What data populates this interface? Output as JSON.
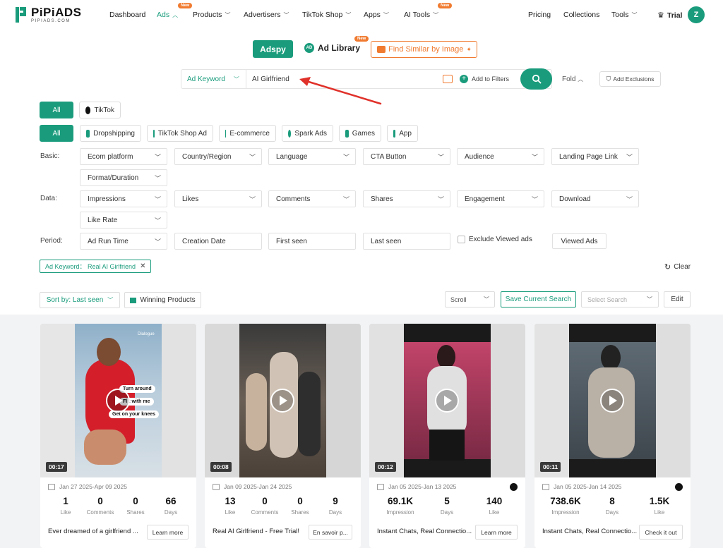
{
  "nav": {
    "logo_main": "PiPiADS",
    "logo_sub": "PIPIADS.COM",
    "items": [
      {
        "label": "Dashboard"
      },
      {
        "label": "Ads",
        "badge": "New"
      },
      {
        "label": "Products"
      },
      {
        "label": "Advertisers"
      },
      {
        "label": "TikTok Shop"
      },
      {
        "label": "Apps"
      },
      {
        "label": "AI Tools",
        "badge": "New"
      },
      {
        "label": "Pricing"
      },
      {
        "label": "Collections"
      },
      {
        "label": "Tools"
      },
      {
        "label": "Trial"
      }
    ],
    "avatar_initial": "Z"
  },
  "modes": {
    "adspy": "Adspy",
    "ad_library": "Ad Library",
    "ad_library_badge": "New",
    "find_similar": "Find Similar by Image"
  },
  "search": {
    "type": "Ad Keyword",
    "value": "AI Girlfriend",
    "add_to_filters": "Add to Filters",
    "fold": "Fold",
    "add_exclusions": "Add Exclusions"
  },
  "platforms": {
    "all": "All",
    "tiktok": "TikTok"
  },
  "categories": {
    "all": "All",
    "items": [
      "Dropshipping",
      "TikTok Shop Ad",
      "E-commerce",
      "Spark Ads",
      "Games",
      "App"
    ]
  },
  "filters": {
    "basic_label": "Basic:",
    "basic": [
      "Ecom platform",
      "Country/Region",
      "Language",
      "CTA Button",
      "Audience",
      "Landing Page Link",
      "Format/Duration"
    ],
    "data_label": "Data:",
    "data": [
      "Impressions",
      "Likes",
      "Comments",
      "Shares",
      "Engagement",
      "Download",
      "Like Rate"
    ],
    "period_label": "Period:",
    "period": [
      "Ad Run Time",
      "Creation Date",
      "First seen",
      "Last seen"
    ],
    "exclude_viewed": "Exclude Viewed ads",
    "viewed_ads": "Viewed Ads"
  },
  "active_tag": "Ad Keyword： Real AI Girlfriend",
  "clear": "Clear",
  "toolbar": {
    "sort": "Sort by: Last seen",
    "winning": "Winning Products",
    "scroll": "Scroll",
    "save_search": "Save Current Search",
    "select_search": "Select Search",
    "edit": "Edit"
  },
  "cards": [
    {
      "duration": "00:17",
      "date": "Jan 27 2025-Apr 09 2025",
      "stats": [
        {
          "v": "1",
          "l": "Like"
        },
        {
          "v": "0",
          "l": "Comments"
        },
        {
          "v": "0",
          "l": "Shares"
        },
        {
          "v": "66",
          "l": "Days"
        }
      ],
      "desc": "Ever dreamed of a girlfriend ...",
      "cta": "Learn more",
      "overlay": [
        "Turn around",
        "Fl t with me",
        "Get on your knees"
      ],
      "brand": "Dialogue"
    },
    {
      "duration": "00:08",
      "date": "Jan 09 2025-Jan 24 2025",
      "stats": [
        {
          "v": "13",
          "l": "Like"
        },
        {
          "v": "0",
          "l": "Comments"
        },
        {
          "v": "0",
          "l": "Shares"
        },
        {
          "v": "9",
          "l": "Days"
        }
      ],
      "desc": "Real AI Girlfriend - Free Trial!",
      "cta": "En savoir p..."
    },
    {
      "duration": "00:12",
      "date": "Jan 05 2025-Jan 13 2025",
      "stats": [
        {
          "v": "69.1K",
          "l": "Impression"
        },
        {
          "v": "5",
          "l": "Days"
        },
        {
          "v": "140",
          "l": "Like"
        }
      ],
      "desc": "Instant Chats, Real Connectio...",
      "cta": "Learn more"
    },
    {
      "duration": "00:11",
      "date": "Jan 05 2025-Jan 14 2025",
      "stats": [
        {
          "v": "738.6K",
          "l": "Impression"
        },
        {
          "v": "8",
          "l": "Days"
        },
        {
          "v": "1.5K",
          "l": "Like"
        }
      ],
      "desc": "Instant Chats, Real Connectio...",
      "cta": "Check it out"
    }
  ],
  "colors": {
    "accent": "#1a9c7c",
    "orange": "#f07a2f",
    "arrow": "#e0312a"
  }
}
